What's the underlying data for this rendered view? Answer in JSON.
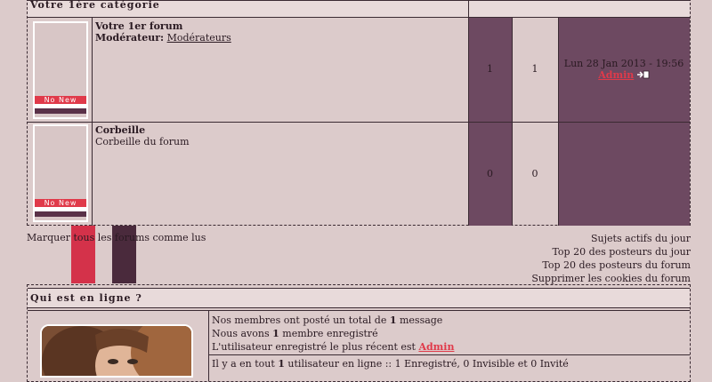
{
  "category": {
    "title": "Votre 1ère catégorie",
    "forums": [
      {
        "name": "Votre 1er forum",
        "moderator_label": "Modérateur:",
        "moderator_value": "Modérateurs",
        "description": "",
        "topics": "1",
        "posts": "1",
        "last_post_date": "Lun 28 Jan 2013 - 19:56",
        "last_post_author": "Admin",
        "thumb_text": "No New"
      },
      {
        "name": "Corbeille",
        "description": "Corbeille du forum",
        "topics": "0",
        "posts": "0",
        "thumb_text": "No New"
      }
    ]
  },
  "links": {
    "mark_read": "Marquer tous les forums comme lus",
    "right": [
      "Sujets actifs du jour",
      "Top 20 des posteurs du jour",
      "Top 20 des posteurs du forum",
      "Supprimer les cookies du forum"
    ]
  },
  "online": {
    "title": "Qui est en ligne ?",
    "line1_pre": "Nos membres ont posté un total de ",
    "line1_num": "1",
    "line1_post": " message",
    "line2_pre": "Nous avons ",
    "line2_num": "1",
    "line2_post": " membre enregistré",
    "line3_pre": "L'utilisateur enregistré le plus récent est ",
    "line3_user": "Admin",
    "line4_pre": "Il y a en tout ",
    "line4_num": "1",
    "line4_post": " utilisateur en ligne :: 1 Enregistré, 0 Invisible et 0 Invité"
  },
  "colors": {
    "background": "#dccbcb",
    "accent_purple": "#6d4961",
    "accent_red": "#e03a4a",
    "dark_plum": "#5a3148"
  },
  "icons": {
    "last_post": "arrow-doc-icon"
  }
}
